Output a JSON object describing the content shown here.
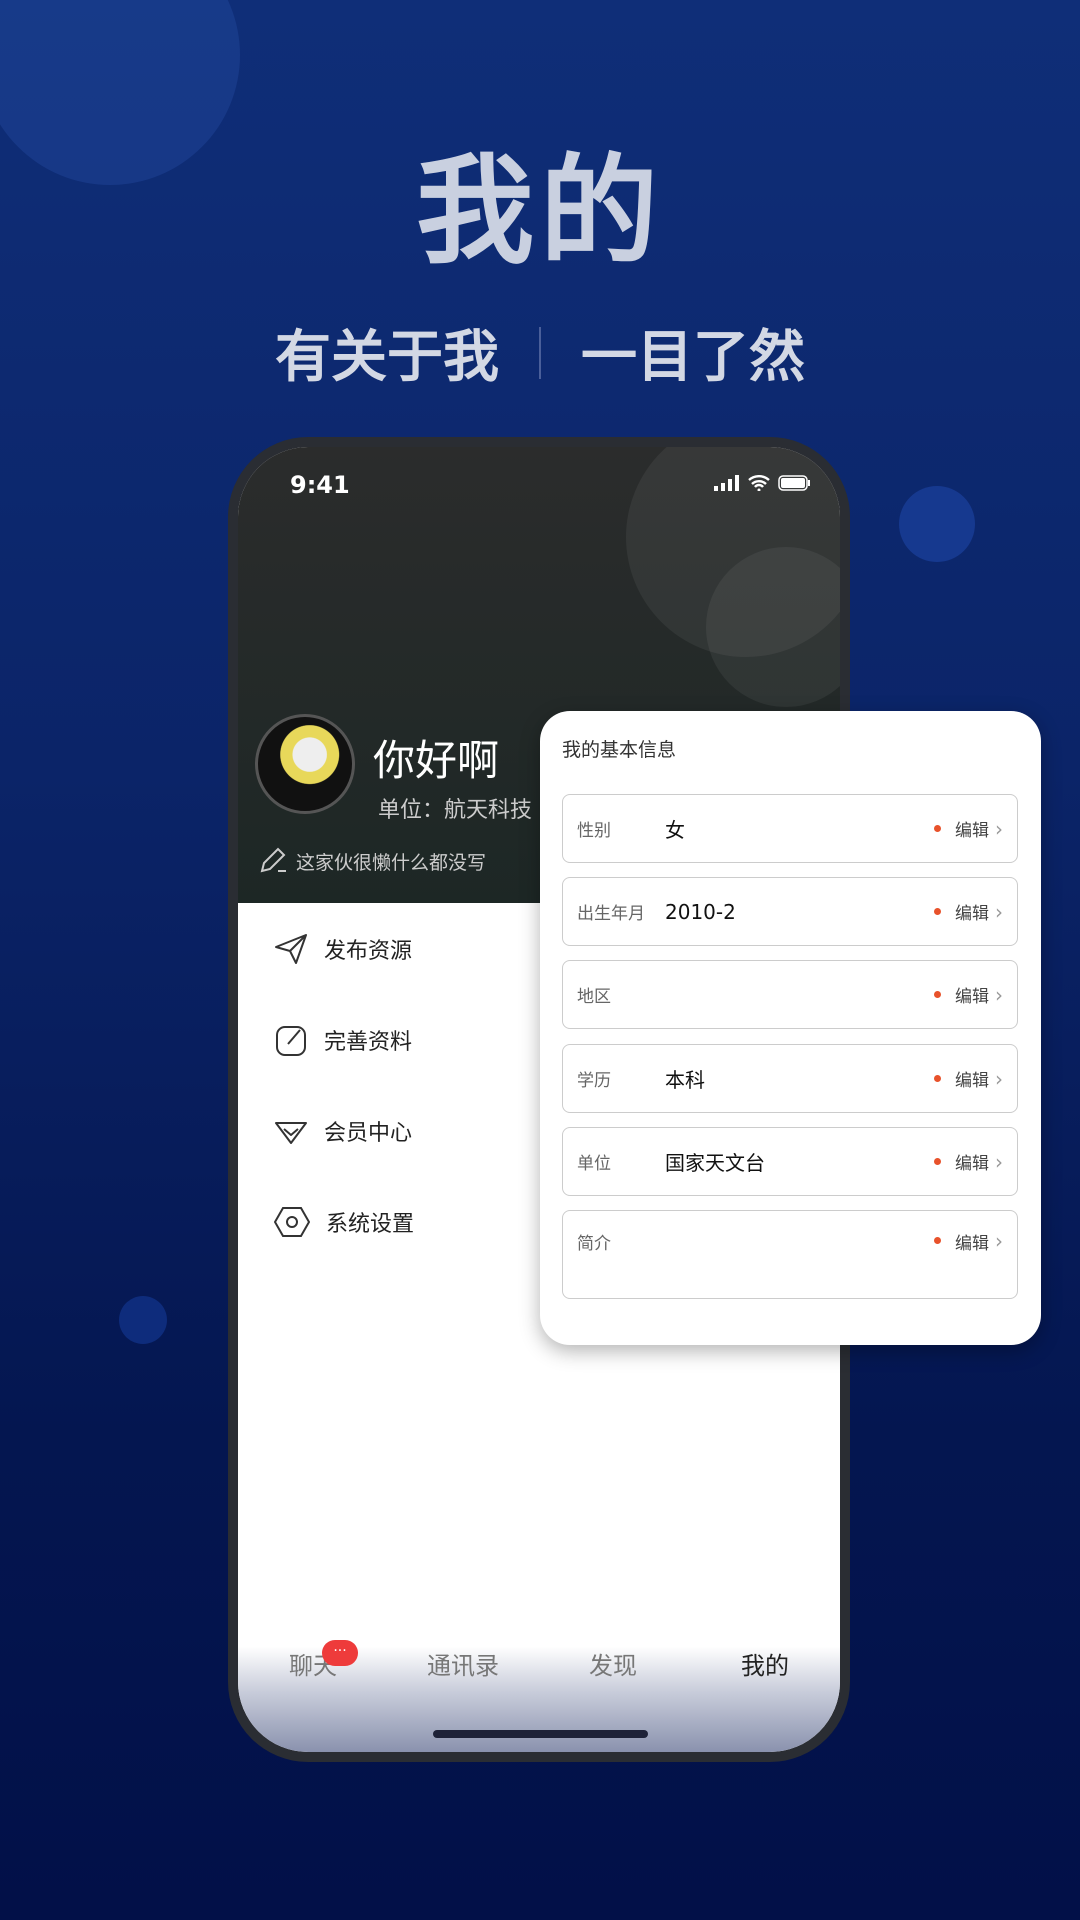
{
  "hero": {
    "title": "我的",
    "subtitle_left": "有关于我",
    "subtitle_right": "一目了然"
  },
  "status_bar": {
    "time": "9:41"
  },
  "profile": {
    "name": "你好啊",
    "unit": "单位：航天科技",
    "signature": "这家伙很懒什么都没写"
  },
  "menu": [
    {
      "label": "发布资源",
      "icon": "paper-plane-icon"
    },
    {
      "label": "完善资料",
      "icon": "edit-square-icon"
    },
    {
      "label": "会员中心",
      "icon": "diamond-icon"
    },
    {
      "label": "系统设置",
      "icon": "hexagon-gear-icon"
    }
  ],
  "info_card": {
    "title": "我的基本信息",
    "edit_label": "编辑",
    "rows": [
      {
        "label": "性别",
        "value": "女"
      },
      {
        "label": "出生年月",
        "value": "2010-2"
      },
      {
        "label": "地区",
        "value": ""
      },
      {
        "label": "学历",
        "value": "本科"
      },
      {
        "label": "单位",
        "value": "国家天文台"
      },
      {
        "label": "简介",
        "value": ""
      }
    ]
  },
  "tabs": [
    {
      "label": "聊天",
      "badge": "···"
    },
    {
      "label": "通讯录"
    },
    {
      "label": "发现"
    },
    {
      "label": "我的",
      "active": true
    }
  ],
  "colors": {
    "accent_dot": "#e8522b",
    "badge": "#ee3b3b",
    "background": "#0b2468"
  }
}
